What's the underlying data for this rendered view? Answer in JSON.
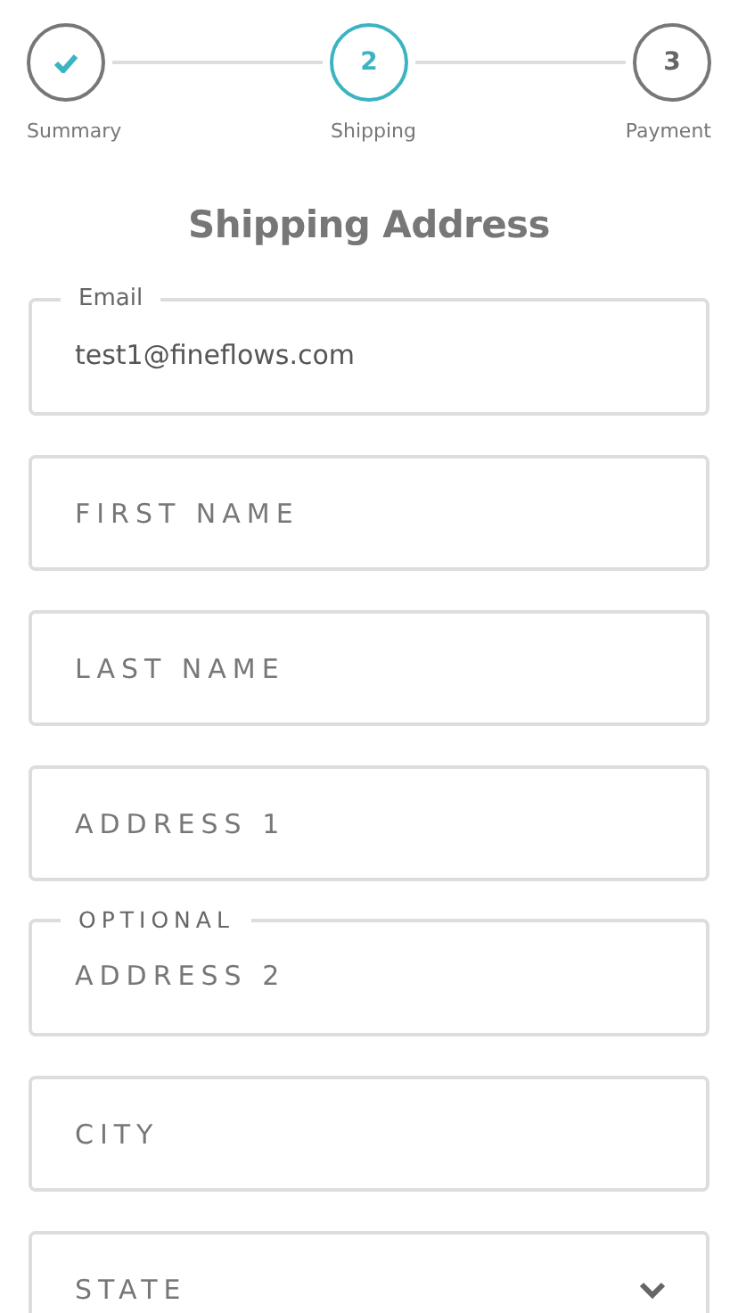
{
  "steps": [
    {
      "label": "Summary",
      "completed": true,
      "selected": false
    },
    {
      "number": "2",
      "label": "Shipping",
      "completed": false,
      "selected": true
    },
    {
      "number": "3",
      "label": "Payment",
      "completed": false,
      "selected": false
    }
  ],
  "title": "Shipping Address",
  "fields": [
    {
      "kind": "text",
      "label": "Email",
      "value": "test1@fineflows.com"
    },
    {
      "kind": "text",
      "placeholder": "FIRST NAME"
    },
    {
      "kind": "text",
      "placeholder": "LAST NAME"
    },
    {
      "kind": "text",
      "placeholder": "ADDRESS 1"
    },
    {
      "kind": "text",
      "label": "OPTIONAL",
      "placeholder": "ADDRESS 2"
    },
    {
      "kind": "text",
      "placeholder": "CITY"
    },
    {
      "kind": "select",
      "placeholder": "STATE"
    }
  ]
}
